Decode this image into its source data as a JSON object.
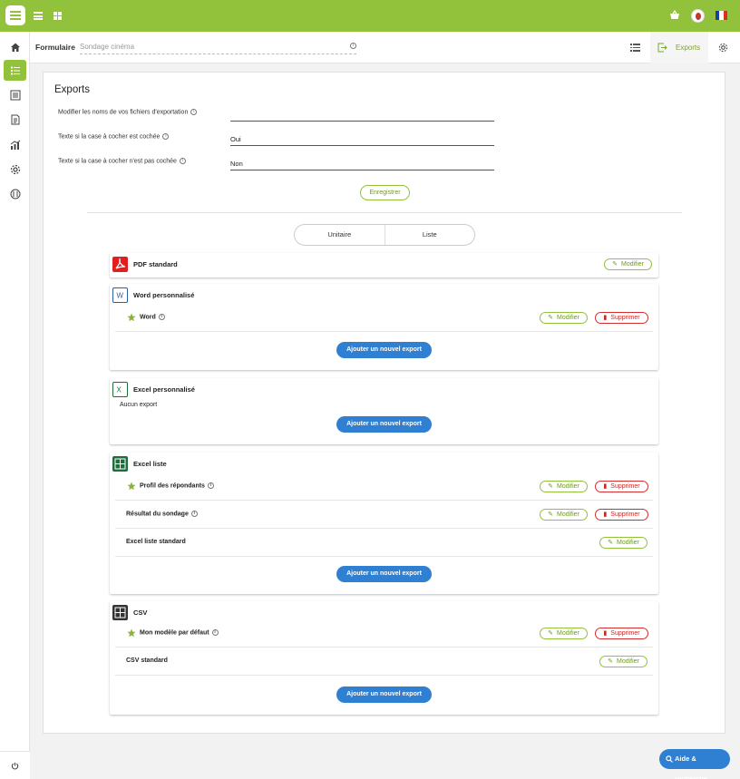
{
  "header": {
    "brand_color": "#92c13b",
    "icons": [
      "app-logo-icon",
      "menu-icon",
      "grid-icon",
      "basket-icon",
      "avatar",
      "flag-fr-icon"
    ]
  },
  "sidebar": {
    "items": [
      "home-icon",
      "form-list-icon",
      "questions-icon",
      "report-icon",
      "stats-icon",
      "settings-icon",
      "compass-icon"
    ],
    "footer_icon": "power-icon"
  },
  "subbar": {
    "form_label": "Formulaire",
    "form_name": "Sondage cinéma",
    "exports_label": "Exports"
  },
  "main": {
    "title": "Exports",
    "fields": [
      {
        "label": "Modifier les noms de vos fichiers d'exportation",
        "value": ""
      },
      {
        "label": "Texte si la case à cocher est cochée",
        "value": "Oui"
      },
      {
        "label": "Texte si la case à cocher n'est pas cochée",
        "value": "Non"
      }
    ],
    "save_label": "Enregistrer",
    "tabs": [
      "Unitaire",
      "Liste"
    ]
  },
  "exports": {
    "modify_label": "Modifier",
    "delete_label": "Supprimer",
    "add_label": "Ajouter un nouvel export",
    "pdf": {
      "title": "PDF standard"
    },
    "word": {
      "title": "Word personnalisé",
      "rows": [
        {
          "name": "Word"
        }
      ]
    },
    "excel": {
      "title": "Excel personnalisé",
      "empty": "Aucun export"
    },
    "excel_list": {
      "title": "Excel liste",
      "rows": [
        {
          "name": "Profil des répondants"
        },
        {
          "name": "Résultat du sondage"
        },
        {
          "name": "Excel liste standard"
        }
      ]
    },
    "csv": {
      "title": "CSV",
      "rows": [
        {
          "name": "Mon modèle par défaut"
        },
        {
          "name": "CSV standard"
        }
      ]
    }
  },
  "help_label": "Aide & recherche"
}
